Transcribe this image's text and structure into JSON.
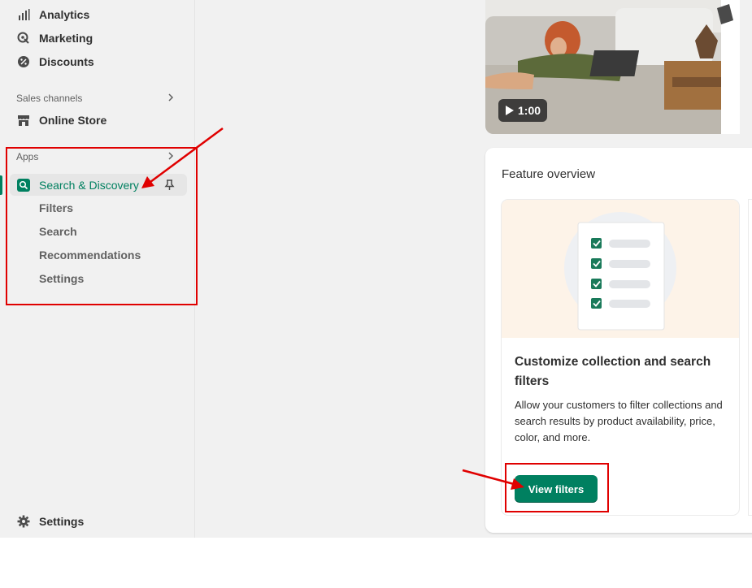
{
  "sidebar": {
    "items": [
      {
        "label": "Analytics",
        "icon": "analytics-icon"
      },
      {
        "label": "Marketing",
        "icon": "marketing-icon"
      },
      {
        "label": "Discounts",
        "icon": "discounts-icon"
      }
    ],
    "sales_channels": {
      "label": "Sales channels",
      "online_store": "Online Store"
    },
    "apps": {
      "label": "Apps",
      "active_app": "Search & Discovery",
      "sub_items": [
        "Filters",
        "Search",
        "Recommendations",
        "Settings"
      ]
    },
    "settings_label": "Settings"
  },
  "video": {
    "duration": "1:00"
  },
  "feature_overview": {
    "title": "Feature overview",
    "card": {
      "title": "Customize collection and search filters",
      "description": "Allow your customers to filter collections and search results by product availability, price, color, and more.",
      "button_label": "View filters"
    }
  },
  "colors": {
    "accent": "#008060",
    "annotation": "#e00000",
    "illustration_bg": "#fdf3e8"
  }
}
